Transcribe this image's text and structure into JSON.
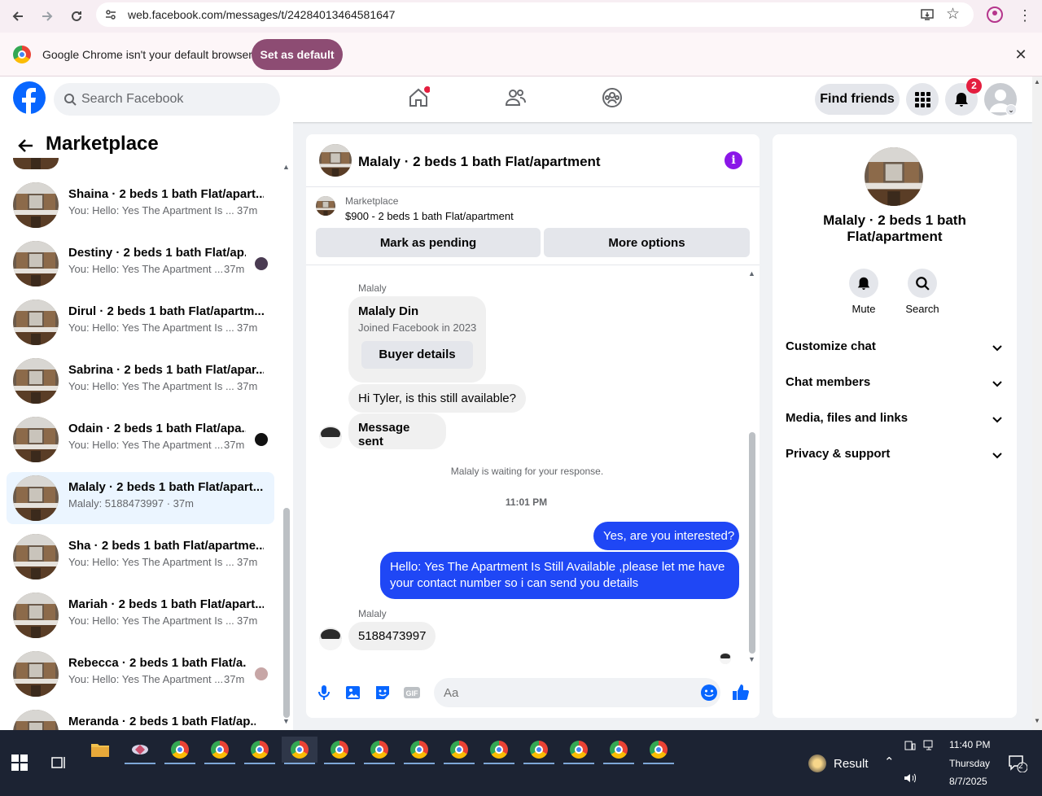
{
  "browser": {
    "url": "web.facebook.com/messages/t/24284013464581647",
    "infobar_text": "Google Chrome isn't your default browser",
    "set_default_label": "Set as default"
  },
  "fb_header": {
    "search_placeholder": "Search Facebook",
    "find_friends_label": "Find friends",
    "notification_count": "2"
  },
  "sidebar": {
    "title": "Marketplace",
    "conversations": [
      {
        "name": "Shaina · 2 beds 1 bath Flat/apart...",
        "preview": "You: Hello: Yes The Apartment Is ...",
        "time": "37m"
      },
      {
        "name": "Destiny · 2 beds 1 bath Flat/ap...",
        "preview": "You: Hello: Yes The Apartment ...",
        "time": "37m"
      },
      {
        "name": "Dirul · 2 beds 1 bath Flat/apartm...",
        "preview": "You: Hello: Yes The Apartment Is ...",
        "time": "37m"
      },
      {
        "name": "Sabrina · 2 beds 1 bath Flat/apar...",
        "preview": "You: Hello: Yes The Apartment Is ...",
        "time": "37m"
      },
      {
        "name": "Odain · 2 beds 1 bath Flat/apa...",
        "preview": "You: Hello: Yes The Apartment ...",
        "time": "37m"
      },
      {
        "name": "Malaly · 2 beds 1 bath Flat/apart...",
        "preview": "Malaly: 5188473997 · 37m",
        "time": ""
      },
      {
        "name": "Sha · 2 beds 1 bath Flat/apartme...",
        "preview": "You: Hello: Yes The Apartment Is ...",
        "time": "37m"
      },
      {
        "name": "Mariah · 2 beds 1 bath Flat/apart...",
        "preview": "You: Hello: Yes The Apartment Is ...",
        "time": "37m"
      },
      {
        "name": "Rebecca · 2 beds 1 bath Flat/a...",
        "preview": "You: Hello: Yes The Apartment ...",
        "time": "37m"
      },
      {
        "name": "Meranda · 2 beds 1 bath Flat/ap...",
        "preview": "",
        "time": ""
      }
    ]
  },
  "chat": {
    "title": "Malaly · 2 beds 1 bath Flat/apartment",
    "listing_source": "Marketplace",
    "listing_title": "$900 - 2 beds 1 bath Flat/apartment",
    "mark_pending_label": "Mark as pending",
    "more_options_label": "More options",
    "sender_name_1": "Malaly",
    "profile_name": "Malaly Din",
    "profile_joined": "Joined Facebook in 2023",
    "buyer_details_label": "Buyer details",
    "msg_in_1": "Hi Tyler, is this still available?",
    "msg_in_2": "Message sent",
    "waiting_text": "Malaly is waiting for your response.",
    "timestamp": "11:01 PM",
    "msg_out_1": "Yes, are you interested?",
    "msg_out_2": "Hello: Yes The Apartment Is Still Available ,please let me have your contact number so i can send you details",
    "sender_name_2": "Malaly",
    "msg_in_3": "5188473997",
    "input_placeholder": "Aa"
  },
  "details": {
    "title": "Malaly · 2 beds 1 bath Flat/apartment",
    "mute_label": "Mute",
    "search_label": "Search",
    "rows": [
      "Customize chat",
      "Chat members",
      "Media, files and links",
      "Privacy & support"
    ]
  },
  "taskbar": {
    "result_label": "Result",
    "time": "11:40 PM",
    "day": "Thursday",
    "date": "8/7/2025",
    "notif_count": "2"
  },
  "colors": {
    "fb_blue": "#0866ff",
    "outgoing_bubble": "#1f47f5",
    "infobar_button": "#8d4c73",
    "notif_red": "#e41e3f",
    "info_purple": "#8a16e8"
  }
}
